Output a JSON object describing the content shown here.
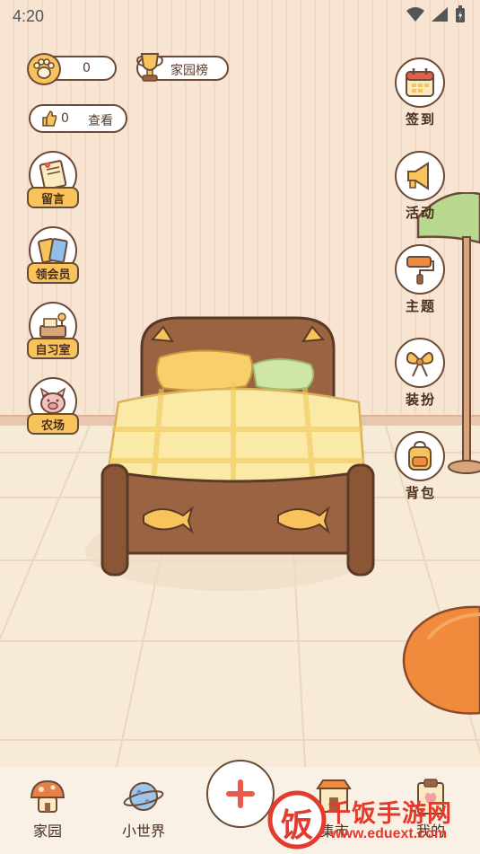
{
  "status_bar": {
    "time": "4:20"
  },
  "top": {
    "paw_count": "0",
    "ranking_label": "家园榜",
    "like_count": "0",
    "view_label": "查看"
  },
  "left_menu": [
    {
      "label": "留言",
      "icon": "message-board-icon"
    },
    {
      "label": "领会员",
      "icon": "membership-cards-icon"
    },
    {
      "label": "自习室",
      "icon": "study-room-icon"
    },
    {
      "label": "农场",
      "icon": "farm-pig-icon"
    }
  ],
  "right_menu": [
    {
      "label": "签到",
      "icon": "calendar-icon"
    },
    {
      "label": "活动",
      "icon": "megaphone-icon"
    },
    {
      "label": "主题",
      "icon": "paint-roller-icon"
    },
    {
      "label": "装扮",
      "icon": "bow-icon"
    },
    {
      "label": "背包",
      "icon": "backpack-icon"
    }
  ],
  "bottom_nav": [
    {
      "label": "家园",
      "icon": "mushroom-house-icon"
    },
    {
      "label": "小世界",
      "icon": "planet-icon"
    },
    {
      "label": "集市",
      "icon": "shop-icon"
    },
    {
      "label": "我的",
      "icon": "clipboard-icon"
    }
  ],
  "add_button_icon": "plus-icon",
  "watermark": {
    "text": "千饭手游网",
    "url": "www.eduext.com",
    "logo_char": "饭"
  },
  "colors": {
    "outline": "#6b4a36",
    "accent_yellow": "#f7c35a",
    "accent_red": "#e85a4a",
    "wall": "#f7e4d3"
  }
}
